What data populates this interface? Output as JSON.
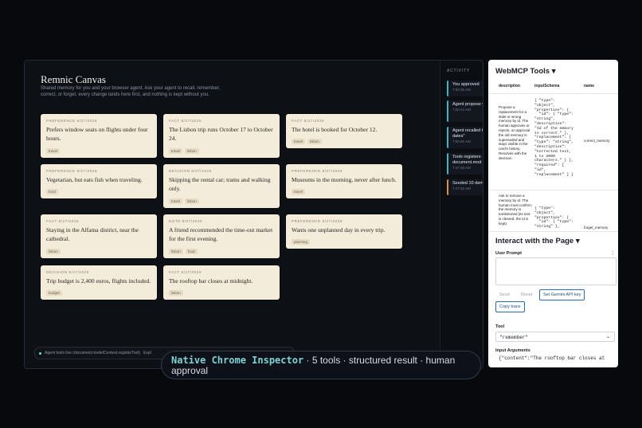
{
  "canvas": {
    "title": "Remnic Canvas",
    "subtitle": "Shared memory for you and your browser agent. Ask your agent to recall, remember, correct, or forget; every change lands here first, and nothing is kept without you.",
    "cards": [
      {
        "kind": "PREFERENCE  8/27/2026",
        "text": "Prefers window seats on flights under four hours.",
        "tags": [
          "travel"
        ]
      },
      {
        "kind": "FACT  8/27/2026",
        "text": "The Lisbon trip runs October 17 to October 24.",
        "tags": [
          "travel",
          "lisbon"
        ]
      },
      {
        "kind": "FACT  8/27/2026",
        "text": "The hotel is booked for October 12.",
        "tags": [
          "travel",
          "lisbon"
        ]
      },
      {
        "kind": "PREFERENCE  8/27/2026",
        "text": "Vegetarian, but eats fish when traveling.",
        "tags": [
          "food"
        ]
      },
      {
        "kind": "DECISION  8/27/2026",
        "text": "Skipping the rental car; trams and walking only.",
        "tags": [
          "travel",
          "lisbon"
        ]
      },
      {
        "kind": "PREFERENCE  8/27/2026",
        "text": "Museums in the morning, never after lunch.",
        "tags": [
          "travel"
        ]
      },
      {
        "kind": "FACT  8/27/2026",
        "text": "Staying in the Alfama district, near the cathedral.",
        "tags": [
          "lisbon"
        ]
      },
      {
        "kind": "NOTE  8/27/2026",
        "text": "A friend recommended the time-out market for the first evening.",
        "tags": [
          "lisbon",
          "food"
        ]
      },
      {
        "kind": "PREFERENCE  8/27/2026",
        "text": "Wants one unplanned day in every trip.",
        "tags": [
          "planning"
        ]
      },
      {
        "kind": "DECISION  8/27/2026",
        "text": "Trip budget is 2,400 euros, flights included.",
        "tags": [
          "budget"
        ]
      },
      {
        "kind": "FACT  8/27/2026",
        "text": "The rooftop bar closes at midnight.",
        "tags": [
          "lisbon"
        ]
      }
    ],
    "status_text": "Agent tools live (document.modelContext.registerTool)",
    "status_extra": "Expl"
  },
  "activity": {
    "header": "ACTIVITY",
    "items": [
      {
        "text": "You approved",
        "time": "7:50:35 AM"
      },
      {
        "text": "Agent propose you",
        "time": "7:50:24 AM"
      },
      {
        "text": "Agent recalled trip dates\"",
        "time": "7:50:05 AM"
      },
      {
        "text": "Tools registere document.mod",
        "time": "7:47:32 AM"
      },
      {
        "text": "Seeded 10 dem",
        "time": "7:47:32 AM"
      }
    ]
  },
  "webmcp": {
    "title": "WebMCP Tools",
    "columns": [
      "description",
      "inputSchema",
      "name"
    ],
    "rows": [
      {
        "description": "Propose a replacement for a stale or wrong memory by id. The human approves or rejects; on approval the old memory is superseded and stays visible in the card's history. Resolves with the decision.",
        "schema": "{ \"type\":\n\"object\",\n\"properties\": {\n  \"id\": { \"type\":\n\"string\",\n\"description\":\n\"Id of the memory\nto correct.\" },\n\"replacement\": {\n\"type\": \"string\",\n\"description\":\n\"Corrected text,\n1 to 2000\ncharacters.\" } },\n\"required\": [\n\"id\",\n\"replacement\" ] }",
        "name": "correct_memory"
      },
      {
        "description": "Ask to remove a memory by id. The human must confirm; the memory is tombstoned (its text is cleared, the id is kept)",
        "schema": "{ \"type\":\n\"object\",\n\"properties\": {\n  \"id\": { \"type\":\n\"string\" },",
        "name": "forget_memory"
      }
    ]
  },
  "interact": {
    "title": "Interact with the Page",
    "prompt_label": "User Prompt",
    "send": "Send",
    "reset": "Reset",
    "set_key": "Set Gemini API key",
    "copy_trace": "Copy trace",
    "tool_label": "Tool",
    "tool_value": "\"remember\"",
    "args_label": "Input Arguments",
    "args_value": "{\"content\":\"The rooftop bar closes at"
  },
  "caption": {
    "accent": "Native Chrome Inspector",
    "rest": " · 5 tools · structured result · human approval"
  }
}
